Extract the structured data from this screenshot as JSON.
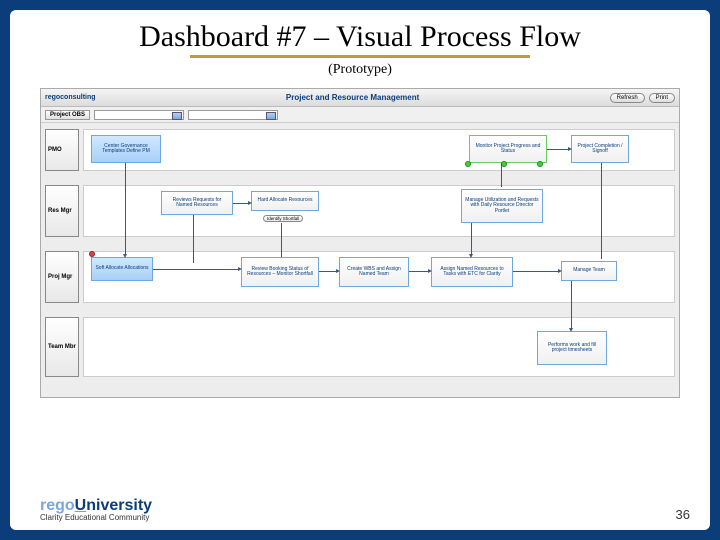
{
  "slide": {
    "title": "Dashboard #7 – Visual Process Flow",
    "subtitle": "(Prototype)",
    "page_number": "36",
    "brand_prefix": "rego",
    "brand_suffix": "niversity",
    "tagline": "Clarity Educational Community"
  },
  "dashboard": {
    "logo_text": "regoconsulting",
    "title": "Project and Resource Management",
    "buttons": {
      "refresh": "Refresh",
      "print": "Print"
    },
    "filter_label": "Project OBS",
    "roles": [
      "PMO",
      "Res Mgr",
      "Proj Mgr",
      "Team Mbr"
    ],
    "boxes": {
      "pmo1": "Center Governance Templates Define PM",
      "pmo2": "Monitor Project Progress and Status",
      "pmo3": "Project Completion / Signoff",
      "rm1": "Reviews Requests for Named Resources",
      "rm2": "Hard Allocate Resources",
      "rm2_sub": "Identify Shortfall",
      "rm3": "Manage Utilization and Requests with Daily Resource Director Portlet",
      "pm1": "Soft Allocate Allocations",
      "pm2": "Review Booking Status of Resources – Monitor Shortfall",
      "pm3": "Create WBS and Assign Named Team",
      "pm4": "Assign Named Resources to Tasks with ETC for Clarity",
      "pm5": "Manage Team",
      "tm1": "Performs work and fill project timesheets"
    }
  }
}
